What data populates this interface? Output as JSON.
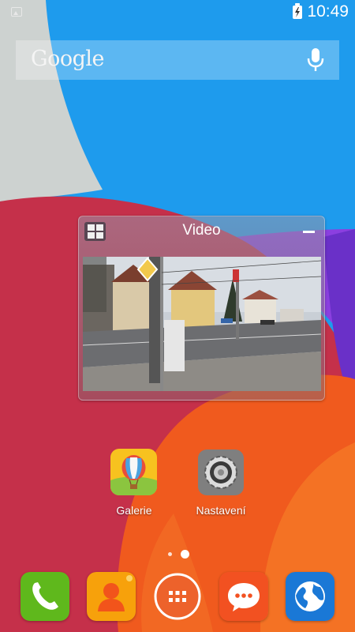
{
  "status_bar": {
    "time": "10:49",
    "left_icon": "image-notification-icon",
    "battery_icon": "battery-charging-icon"
  },
  "search_widget": {
    "label": "Google",
    "mic_icon": "microphone-icon"
  },
  "video_widget": {
    "title": "Video",
    "grid_icon": "grid-icon",
    "minimize_icon": "minimize-icon"
  },
  "apps": [
    {
      "label": "Galerie",
      "icon": "hot-air-balloon-icon"
    },
    {
      "label": "Nastavení",
      "icon": "settings-icon"
    }
  ],
  "page_indicator": {
    "pages": 2,
    "current": 2
  },
  "dock": [
    {
      "icon": "phone-icon",
      "color": "#5fb81c"
    },
    {
      "icon": "contacts-icon",
      "color": "#f7a10b"
    },
    {
      "icon": "app-drawer-icon",
      "color": "#ffffff"
    },
    {
      "icon": "messages-icon",
      "color": "#f25121"
    },
    {
      "icon": "browser-icon",
      "color": "#1a78d6"
    }
  ],
  "colors": {
    "wallpaper_blue": "#1e9bed",
    "wallpaper_red": "#c5304a",
    "wallpaper_orange": "#f05a1e",
    "wallpaper_gray": "#cdd2d0",
    "wallpaper_purple": "#8b3fe0"
  }
}
